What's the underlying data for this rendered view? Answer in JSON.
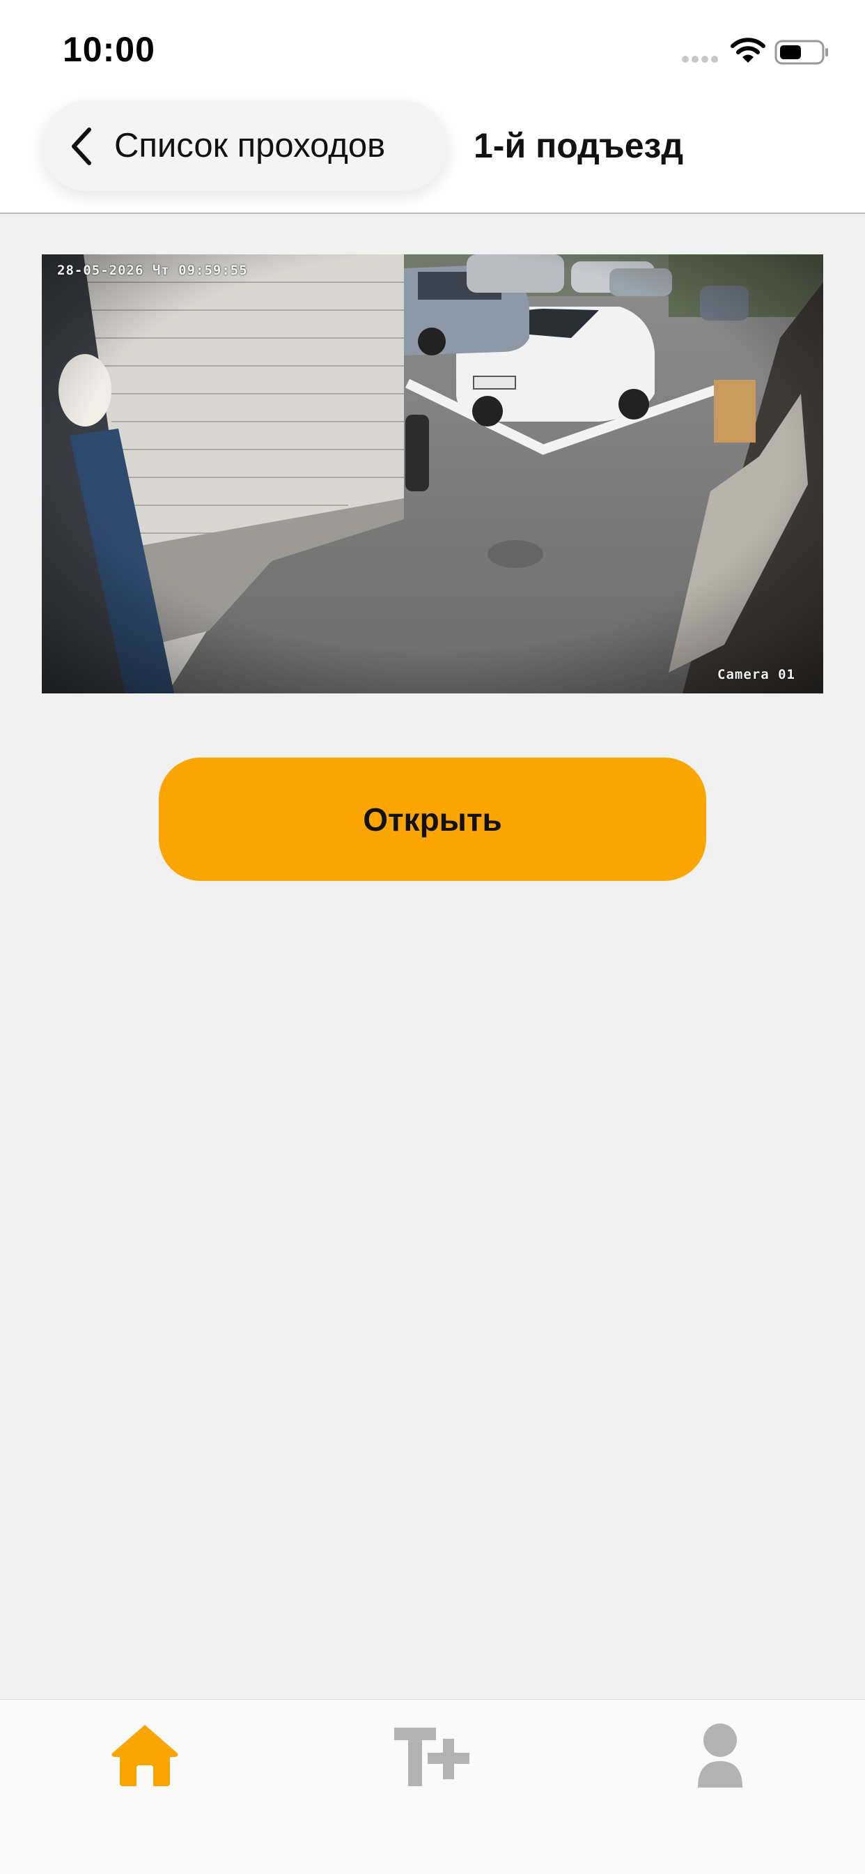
{
  "status_bar": {
    "time": "10:00"
  },
  "nav": {
    "back_label": "Список проходов",
    "title": "1-й подъезд"
  },
  "camera": {
    "timestamp": "28-05-2026 Чт 09:59:55",
    "label": "Camera 01"
  },
  "actions": {
    "open_label": "Открыть"
  },
  "tab_bar": {
    "active_color": "#fba502",
    "inactive_color": "#b3b3b3",
    "tabs": [
      {
        "icon": "home-icon",
        "active": true
      },
      {
        "icon": "t-plus-icon",
        "active": false
      },
      {
        "icon": "profile-icon",
        "active": false
      }
    ]
  },
  "colors": {
    "accent": "#fba502",
    "background": "#f1f1f1"
  }
}
